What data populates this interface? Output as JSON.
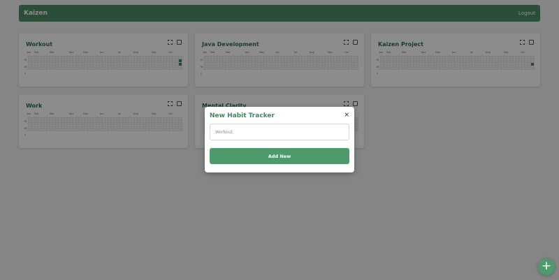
{
  "app": {
    "brand": "Kaizen",
    "logout_label": "Logout"
  },
  "months": [
    "Jan",
    "Feb",
    "Mar",
    "Apr",
    "May",
    "Jun",
    "Jul",
    "Aug",
    "Sep",
    "Oct"
  ],
  "days": [
    "M",
    "W",
    "F"
  ],
  "cards": [
    {
      "title": "Workout"
    },
    {
      "title": "Java Development"
    },
    {
      "title": "Kaizen Project"
    },
    {
      "title": "Work"
    },
    {
      "title": "Mental Clarity"
    }
  ],
  "modal": {
    "title": "New Habit Tracker",
    "close_label": "×",
    "input_value": "",
    "input_placeholder": "Workout",
    "submit_label": "Add New"
  },
  "fab": {
    "label": "+"
  },
  "colors": {
    "brand": "#4f8f68",
    "accent": "#4f9a6d",
    "filled_cell": "#3f8a5e"
  }
}
